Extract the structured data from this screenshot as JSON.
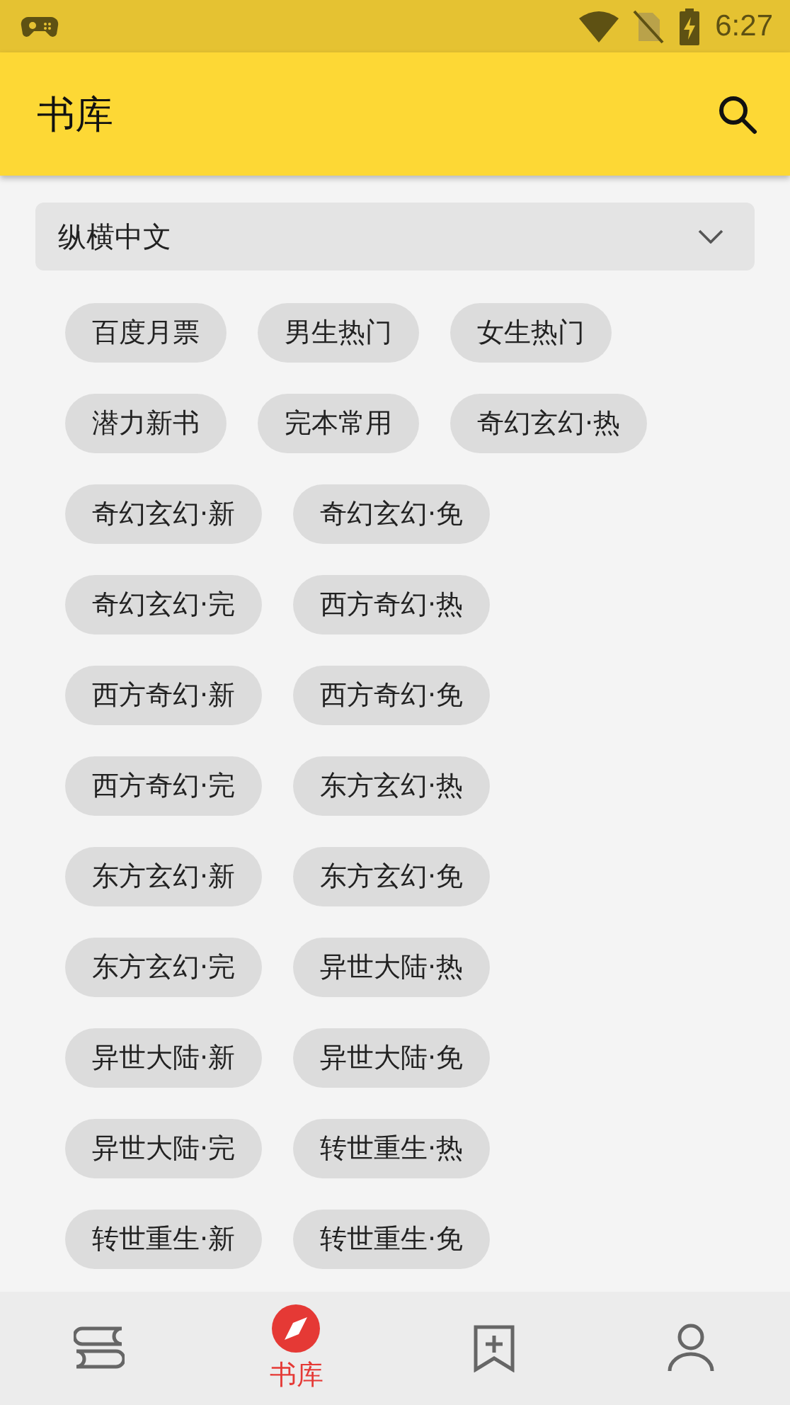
{
  "status_bar": {
    "time": "6:27"
  },
  "app_bar": {
    "title": "书库"
  },
  "source_dropdown": {
    "value": "纵横中文"
  },
  "tags": [
    "百度月票",
    "男生热门",
    "女生热门",
    "潜力新书",
    "完本常用",
    "奇幻玄幻·热",
    "奇幻玄幻·新",
    "奇幻玄幻·免",
    "奇幻玄幻·完",
    "西方奇幻·热",
    "西方奇幻·新",
    "西方奇幻·免",
    "西方奇幻·完",
    "东方玄幻·热",
    "东方玄幻·新",
    "东方玄幻·免",
    "东方玄幻·完",
    "异世大陆·热",
    "异世大陆·新",
    "异世大陆·免",
    "异世大陆·完",
    "转世重生·热",
    "转世重生·新",
    "转世重生·免"
  ],
  "bottom_nav": [
    {
      "kind": "books",
      "selected": false
    },
    {
      "kind": "compass",
      "label": "书库",
      "selected": true
    },
    {
      "kind": "bookmark",
      "selected": false
    },
    {
      "kind": "person",
      "selected": false
    }
  ]
}
